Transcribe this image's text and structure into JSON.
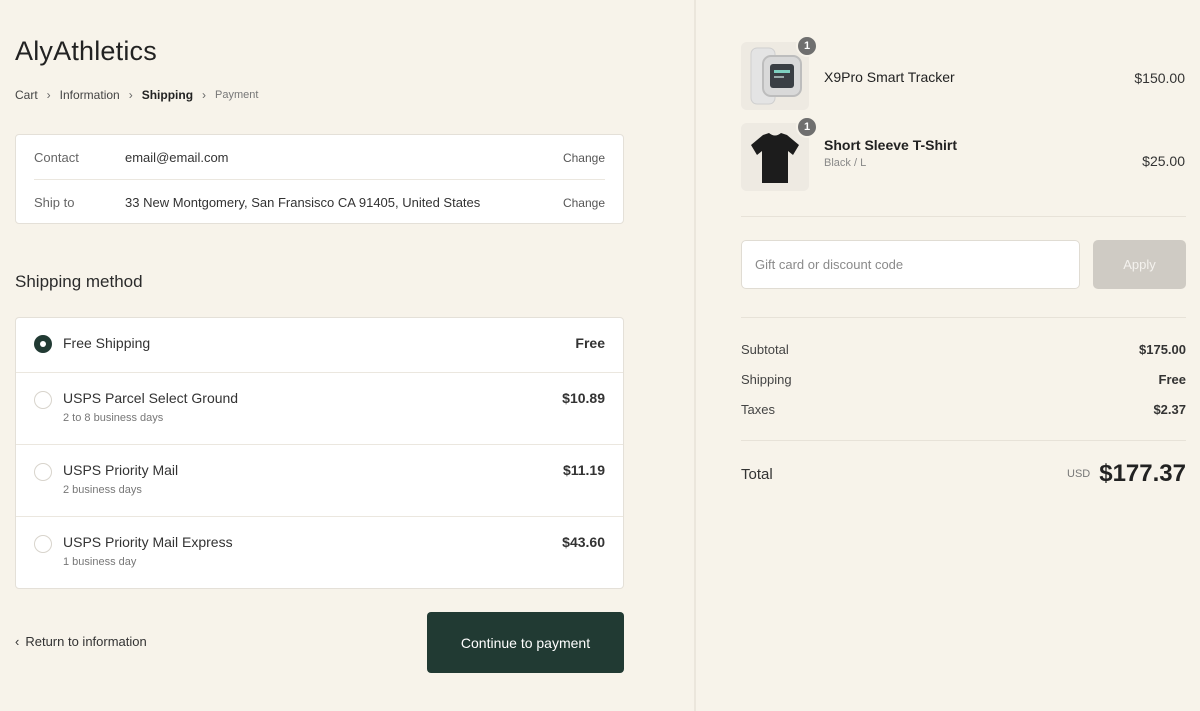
{
  "brand": "AlyAthletics",
  "breadcrumb": {
    "cart": "Cart",
    "information": "Information",
    "shipping": "Shipping",
    "payment": "Payment",
    "separator": ">"
  },
  "review": {
    "contact_label": "Contact",
    "contact_value": "email@email.com",
    "shipto_label": "Ship to",
    "shipto_value": "33 New Montgomery, San Fransisco CA 91405, United States",
    "change_label": "Change"
  },
  "shipping_method": {
    "title": "Shipping method",
    "options": [
      {
        "name": "Free Shipping",
        "sub": "",
        "price": "Free",
        "selected": true
      },
      {
        "name": "USPS Parcel Select Ground",
        "sub": "2 to 8 business days",
        "price": "$10.89",
        "selected": false
      },
      {
        "name": "USPS Priority Mail",
        "sub": "2 business days",
        "price": "$11.19",
        "selected": false
      },
      {
        "name": "USPS Priority Mail Express",
        "sub": "1 business day",
        "price": "$43.60",
        "selected": false
      }
    ]
  },
  "actions": {
    "return_label": "Return to information",
    "continue_label": "Continue to payment"
  },
  "cart": {
    "items": [
      {
        "name": "X9Pro Smart Tracker",
        "variant": "",
        "price": "$150.00",
        "qty": "1",
        "icon": "smartwatch-icon"
      },
      {
        "name": "Short Sleeve T-Shirt",
        "variant": "Black / L",
        "price": "$25.00",
        "qty": "1",
        "icon": "tshirt-icon"
      }
    ]
  },
  "discount": {
    "placeholder": "Gift card or discount code",
    "apply_label": "Apply"
  },
  "summary": {
    "subtotal_label": "Subtotal",
    "subtotal_value": "$175.00",
    "shipping_label": "Shipping",
    "shipping_value": "Free",
    "taxes_label": "Taxes",
    "taxes_value": "$2.37",
    "total_label": "Total",
    "currency": "USD",
    "total_value": "$177.37"
  },
  "colors": {
    "background": "#f7f3ea",
    "primary_button": "#213a33",
    "disabled_button": "#cfcbc4",
    "card": "#ffffff"
  }
}
